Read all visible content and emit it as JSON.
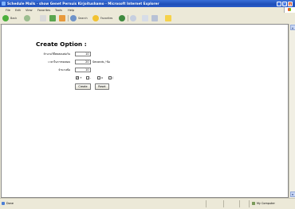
{
  "window": {
    "title": "Schedule Mails - show Genet Pernuis Kirjoitushamo - Microsoft Internet Explorer",
    "controls": {
      "minimize": "_",
      "maximize": "□",
      "close": "×"
    }
  },
  "menu": [
    "File",
    "Edit",
    "View",
    "Favorites",
    "Tools",
    "Help"
  ],
  "toolbar": {
    "back_label": "Back",
    "search_label": "Search",
    "favorites_label": "Favorites"
  },
  "form": {
    "title": "Create Option :",
    "fields": [
      {
        "label": "จำนวนวิธีทดสอบต่อวัน",
        "value": "10",
        "unit": ""
      },
      {
        "label": "เวลาในการทดสอบ",
        "value": "20",
        "unit": "Seconds / ข้อ"
      },
      {
        "label": "จำนวนข้อ",
        "value": "10",
        "unit": ""
      }
    ],
    "checkboxes": [
      {
        "label": "+",
        "checked": true
      },
      {
        "label": "-",
        "checked": false
      },
      {
        "label": "x",
        "checked": false
      },
      {
        "label": "/",
        "checked": false
      }
    ],
    "checkmark": "✓",
    "buttons": {
      "create": "Create",
      "reset": "Reset"
    }
  },
  "status": {
    "text": "Done",
    "zone": "My Computer"
  },
  "colors": {
    "titlebar": "#2a5cc8",
    "chrome": "#ece9d8",
    "page": "#ffffff"
  }
}
